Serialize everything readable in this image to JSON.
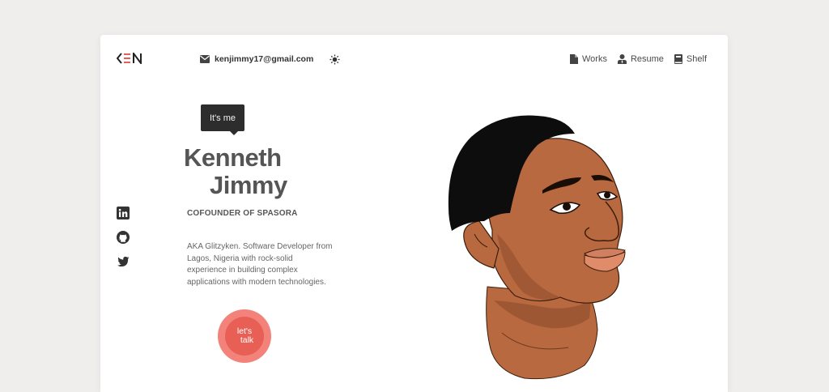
{
  "header": {
    "logo_text": "KEN",
    "email": "kenjimmy17@gmail.com",
    "nav": [
      {
        "label": "Works",
        "icon": "file-icon"
      },
      {
        "label": "Resume",
        "icon": "user-tie-icon"
      },
      {
        "label": "Shelf",
        "icon": "book-icon"
      }
    ]
  },
  "hero": {
    "tooltip": "It's me",
    "first_name": "Kenneth",
    "last_name": "Jimmy",
    "role": "COFOUNDER OF SPASORA",
    "bio": "AKA Glitzyken. Software Developer from Lagos, Nigeria with rock-solid experience in building complex applications with modern technologies.",
    "cta_line1": "let's",
    "cta_line2": "talk"
  },
  "social": [
    "linkedin-icon",
    "github-icon",
    "twitter-icon"
  ],
  "colors": {
    "accent": "#e85f55",
    "accent_light": "#f3837a",
    "text_dark": "#555555",
    "skin": "#b8693f"
  }
}
